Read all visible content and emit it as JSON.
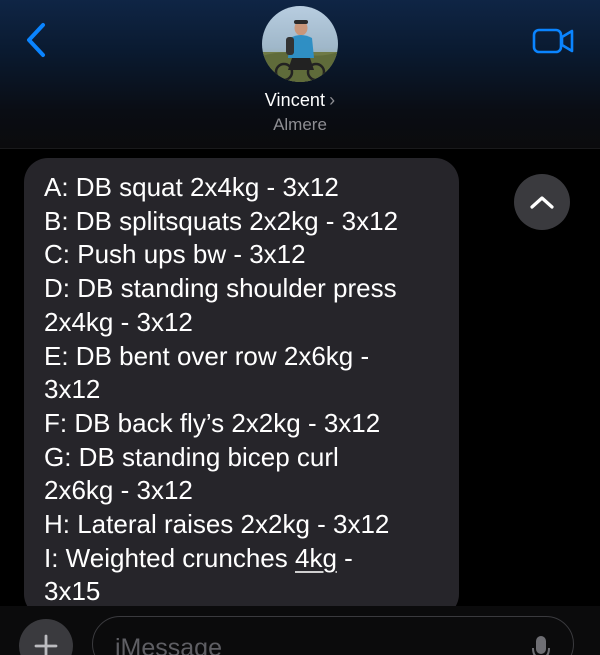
{
  "header": {
    "contact_name": "Vincent",
    "contact_location": "Almere",
    "back_icon": "chevron-left-icon",
    "video_icon": "video-camera-icon",
    "accent_color": "#0a84ff"
  },
  "messages": [
    {
      "direction": "incoming",
      "lines": [
        "A: DB squat 2x4kg - 3x12",
        "B: DB splitsquats 2x2kg - 3x12",
        "C: Push ups bw - 3x12",
        "D: DB standing shoulder press",
        "2x4kg - 3x12",
        "E: DB bent over row 2x6kg -",
        "3x12",
        "F: DB back fly’s 2x2kg - 3x12",
        "G: DB standing bicep curl",
        "2x6kg - 3x12",
        "H: Lateral raises 2x2kg - 3x12"
      ],
      "line_i_prefix": "I: Weighted crunches ",
      "line_i_link": "4kg",
      "line_i_suffix": " -",
      "last_line": "3x15"
    }
  ],
  "controls": {
    "scroll_up_icon": "chevron-up-icon",
    "plus_icon": "plus-icon",
    "mic_icon": "microphone-icon"
  },
  "input": {
    "placeholder": "iMessage"
  }
}
